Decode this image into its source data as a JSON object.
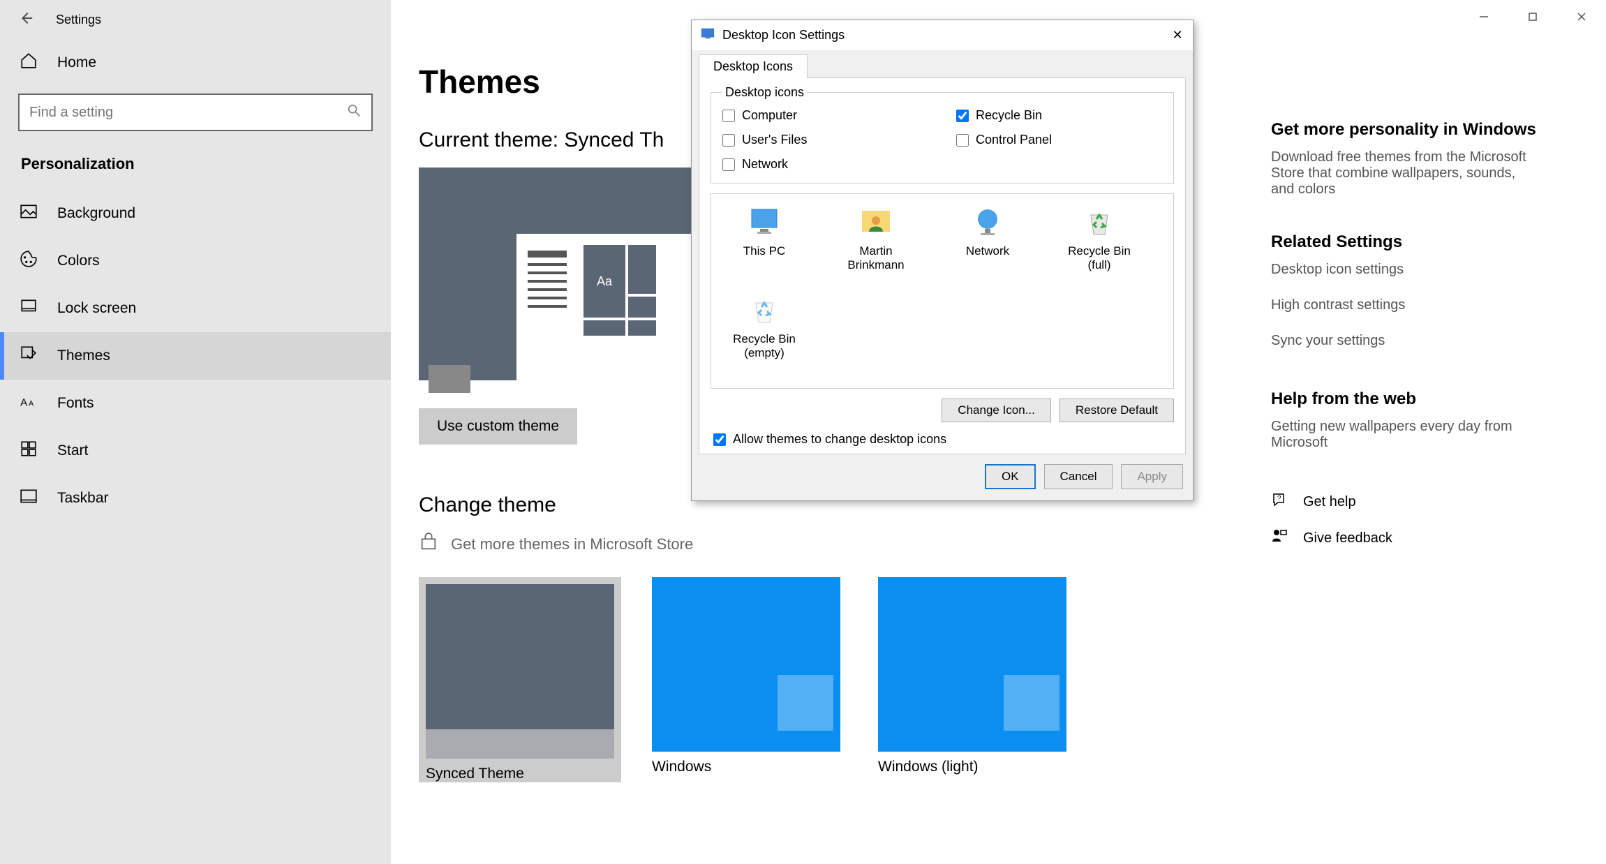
{
  "window": {
    "title": "Settings"
  },
  "sidebar": {
    "home": "Home",
    "search_placeholder": "Find a setting",
    "section": "Personalization",
    "items": [
      {
        "label": "Background"
      },
      {
        "label": "Colors"
      },
      {
        "label": "Lock screen"
      },
      {
        "label": "Themes"
      },
      {
        "label": "Fonts"
      },
      {
        "label": "Start"
      },
      {
        "label": "Taskbar"
      }
    ]
  },
  "main": {
    "heading": "Themes",
    "current_label": "Current theme: Synced Th",
    "preview_aa": "Aa",
    "custom_btn": "Use custom theme",
    "change_heading": "Change theme",
    "store_link": "Get more themes in Microsoft Store",
    "themes": [
      {
        "label": "Synced Theme"
      },
      {
        "label": "Windows"
      },
      {
        "label": "Windows (light)"
      }
    ]
  },
  "right": {
    "more_title": "Get more personality in Windows",
    "more_body": "Download free themes from the Microsoft Store that combine wallpapers, sounds, and colors",
    "related_title": "Related Settings",
    "links": [
      "Desktop icon settings",
      "High contrast settings",
      "Sync your settings"
    ],
    "help_title": "Help from the web",
    "help_links": [
      "Getting new wallpapers every day from Microsoft"
    ],
    "get_help": "Get help",
    "feedback": "Give feedback"
  },
  "dialog": {
    "title": "Desktop Icon Settings",
    "tab": "Desktop Icons",
    "group_label": "Desktop icons",
    "checks": [
      {
        "label": "Computer",
        "checked": false
      },
      {
        "label": "Recycle Bin",
        "checked": true
      },
      {
        "label": "User's Files",
        "checked": false
      },
      {
        "label": "Control Panel",
        "checked": false
      },
      {
        "label": "Network",
        "checked": false
      }
    ],
    "icons": [
      "This PC",
      "Martin Brinkmann",
      "Network",
      "Recycle Bin (full)",
      "Recycle Bin (empty)"
    ],
    "change_icon": "Change Icon...",
    "restore": "Restore Default",
    "allow": "Allow themes to change desktop icons",
    "allow_checked": true,
    "ok": "OK",
    "cancel": "Cancel",
    "apply": "Apply"
  }
}
